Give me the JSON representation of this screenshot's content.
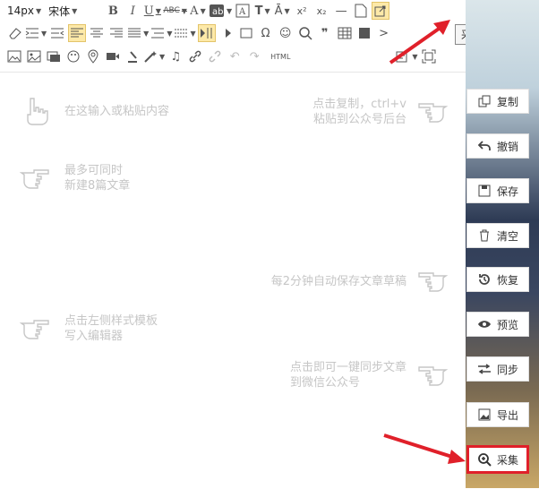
{
  "toolbar": {
    "font_size": "14px",
    "font_family": "宋体",
    "html_label": "HTML",
    "tooltip": "采集文章"
  },
  "hints": {
    "input": "在这输入或粘贴内容",
    "copy_line1": "点击复制，ctrl+v",
    "copy_line2": "粘贴到公众号后台",
    "max_line1": "最多可同时",
    "max_line2": "新建8篇文章",
    "autosave": "每2分钟自动保存文章草稿",
    "style_line1": "点击左侧样式模板",
    "style_line2": "写入编辑器",
    "sync_line1": "点击即可一键同步文章",
    "sync_line2": "到微信公众号"
  },
  "sidebar": {
    "copy": "复制",
    "undo": "撤销",
    "save": "保存",
    "clear": "清空",
    "restore": "恢复",
    "preview": "预览",
    "sync": "同步",
    "export": "导出",
    "collect": "采集"
  },
  "colors": {
    "highlight": "#e0202a",
    "hint_text": "#c6c6c6",
    "active_tool": "#fde9a8"
  }
}
